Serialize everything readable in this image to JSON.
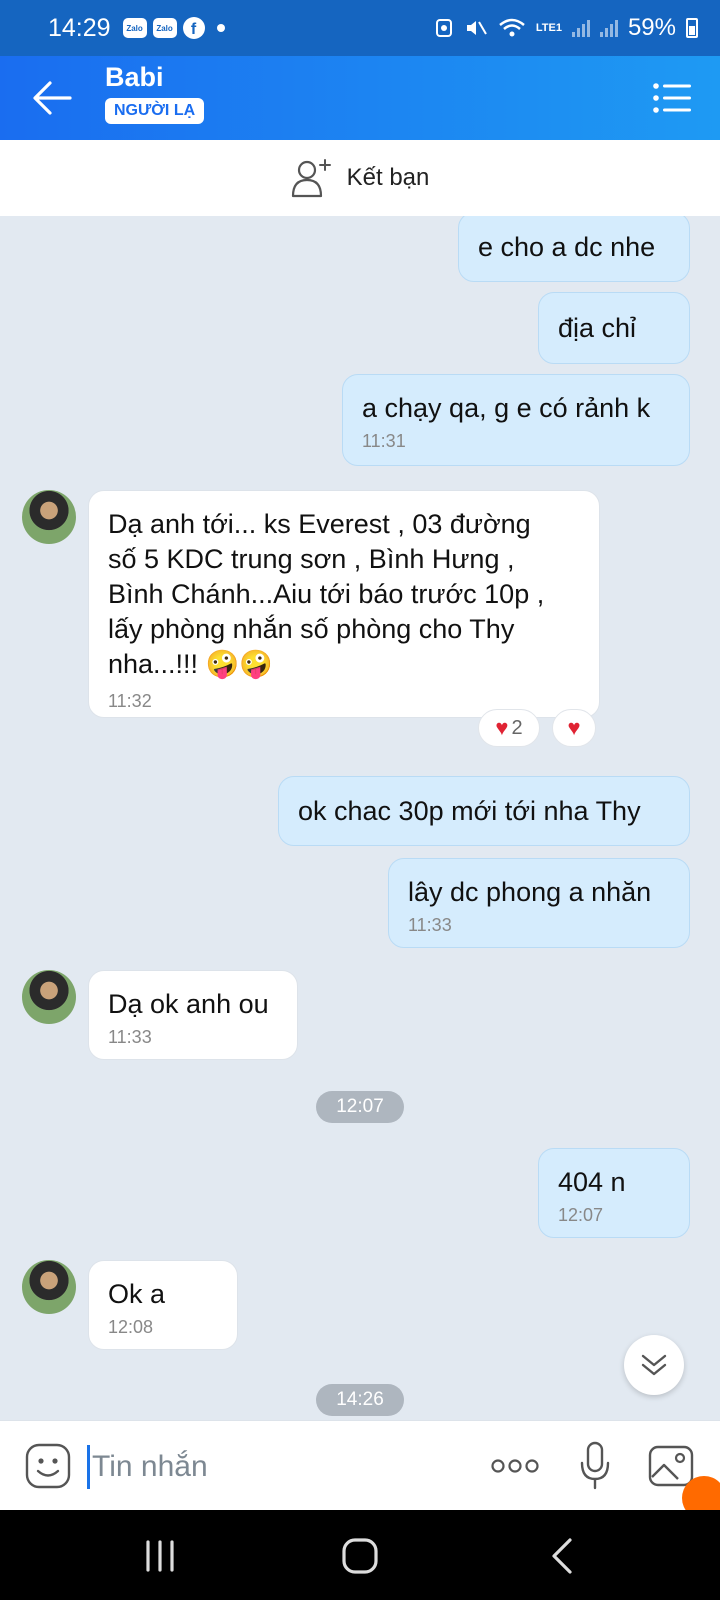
{
  "status_bar": {
    "time": "14:29",
    "app_icons": [
      "Zalo",
      "Zalo"
    ],
    "facebook": "f",
    "network": "LTE1",
    "battery": "59%"
  },
  "header": {
    "title": "Babi",
    "badge": "NGƯỜI LẠ"
  },
  "add_friend": {
    "label": "Kết bạn"
  },
  "messages": [
    {
      "text": "e cho a dc nhe"
    },
    {
      "text": "địa chỉ"
    },
    {
      "text": "a chạy qa, g e có rảnh k",
      "time": "11:31"
    },
    {
      "lines": [
        "Dạ anh tới... ks Everest , 03 đường",
        "số 5 KDC trung sơn , Bình Hưng ,",
        "Bình Chánh...Aiu tới báo trước 10p ,",
        "lấy phòng nhắn số phòng cho Thy",
        "nha...!!! 🤪🤪"
      ],
      "time": "11:32",
      "reaction_count": "2"
    },
    {
      "text": "ok chac 30p mới tới nha Thy"
    },
    {
      "text": "lây dc phong a nhăn",
      "time": "11:33"
    },
    {
      "text": "Dạ ok anh ou",
      "time": "11:33"
    },
    {
      "text": "404 n",
      "time": "12:07"
    },
    {
      "text": "Ok a",
      "time": "12:08"
    }
  ],
  "separators": [
    "12:07",
    "14:26"
  ],
  "reaction_icon": "♥",
  "input": {
    "placeholder": "Tin nhắn"
  }
}
